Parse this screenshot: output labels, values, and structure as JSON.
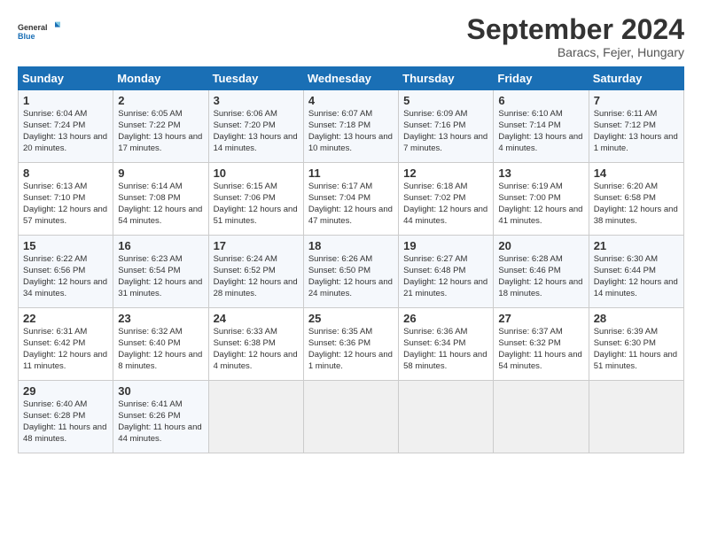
{
  "logo": {
    "line1": "General",
    "line2": "Blue"
  },
  "title": "September 2024",
  "subtitle": "Baracs, Fejer, Hungary",
  "days_of_week": [
    "Sunday",
    "Monday",
    "Tuesday",
    "Wednesday",
    "Thursday",
    "Friday",
    "Saturday"
  ],
  "weeks": [
    [
      {
        "day": "1",
        "rise": "Sunrise: 6:04 AM",
        "set": "Sunset: 7:24 PM",
        "daylight": "Daylight: 13 hours and 20 minutes."
      },
      {
        "day": "2",
        "rise": "Sunrise: 6:05 AM",
        "set": "Sunset: 7:22 PM",
        "daylight": "Daylight: 13 hours and 17 minutes."
      },
      {
        "day": "3",
        "rise": "Sunrise: 6:06 AM",
        "set": "Sunset: 7:20 PM",
        "daylight": "Daylight: 13 hours and 14 minutes."
      },
      {
        "day": "4",
        "rise": "Sunrise: 6:07 AM",
        "set": "Sunset: 7:18 PM",
        "daylight": "Daylight: 13 hours and 10 minutes."
      },
      {
        "day": "5",
        "rise": "Sunrise: 6:09 AM",
        "set": "Sunset: 7:16 PM",
        "daylight": "Daylight: 13 hours and 7 minutes."
      },
      {
        "day": "6",
        "rise": "Sunrise: 6:10 AM",
        "set": "Sunset: 7:14 PM",
        "daylight": "Daylight: 13 hours and 4 minutes."
      },
      {
        "day": "7",
        "rise": "Sunrise: 6:11 AM",
        "set": "Sunset: 7:12 PM",
        "daylight": "Daylight: 13 hours and 1 minute."
      }
    ],
    [
      {
        "day": "8",
        "rise": "Sunrise: 6:13 AM",
        "set": "Sunset: 7:10 PM",
        "daylight": "Daylight: 12 hours and 57 minutes."
      },
      {
        "day": "9",
        "rise": "Sunrise: 6:14 AM",
        "set": "Sunset: 7:08 PM",
        "daylight": "Daylight: 12 hours and 54 minutes."
      },
      {
        "day": "10",
        "rise": "Sunrise: 6:15 AM",
        "set": "Sunset: 7:06 PM",
        "daylight": "Daylight: 12 hours and 51 minutes."
      },
      {
        "day": "11",
        "rise": "Sunrise: 6:17 AM",
        "set": "Sunset: 7:04 PM",
        "daylight": "Daylight: 12 hours and 47 minutes."
      },
      {
        "day": "12",
        "rise": "Sunrise: 6:18 AM",
        "set": "Sunset: 7:02 PM",
        "daylight": "Daylight: 12 hours and 44 minutes."
      },
      {
        "day": "13",
        "rise": "Sunrise: 6:19 AM",
        "set": "Sunset: 7:00 PM",
        "daylight": "Daylight: 12 hours and 41 minutes."
      },
      {
        "day": "14",
        "rise": "Sunrise: 6:20 AM",
        "set": "Sunset: 6:58 PM",
        "daylight": "Daylight: 12 hours and 38 minutes."
      }
    ],
    [
      {
        "day": "15",
        "rise": "Sunrise: 6:22 AM",
        "set": "Sunset: 6:56 PM",
        "daylight": "Daylight: 12 hours and 34 minutes."
      },
      {
        "day": "16",
        "rise": "Sunrise: 6:23 AM",
        "set": "Sunset: 6:54 PM",
        "daylight": "Daylight: 12 hours and 31 minutes."
      },
      {
        "day": "17",
        "rise": "Sunrise: 6:24 AM",
        "set": "Sunset: 6:52 PM",
        "daylight": "Daylight: 12 hours and 28 minutes."
      },
      {
        "day": "18",
        "rise": "Sunrise: 6:26 AM",
        "set": "Sunset: 6:50 PM",
        "daylight": "Daylight: 12 hours and 24 minutes."
      },
      {
        "day": "19",
        "rise": "Sunrise: 6:27 AM",
        "set": "Sunset: 6:48 PM",
        "daylight": "Daylight: 12 hours and 21 minutes."
      },
      {
        "day": "20",
        "rise": "Sunrise: 6:28 AM",
        "set": "Sunset: 6:46 PM",
        "daylight": "Daylight: 12 hours and 18 minutes."
      },
      {
        "day": "21",
        "rise": "Sunrise: 6:30 AM",
        "set": "Sunset: 6:44 PM",
        "daylight": "Daylight: 12 hours and 14 minutes."
      }
    ],
    [
      {
        "day": "22",
        "rise": "Sunrise: 6:31 AM",
        "set": "Sunset: 6:42 PM",
        "daylight": "Daylight: 12 hours and 11 minutes."
      },
      {
        "day": "23",
        "rise": "Sunrise: 6:32 AM",
        "set": "Sunset: 6:40 PM",
        "daylight": "Daylight: 12 hours and 8 minutes."
      },
      {
        "day": "24",
        "rise": "Sunrise: 6:33 AM",
        "set": "Sunset: 6:38 PM",
        "daylight": "Daylight: 12 hours and 4 minutes."
      },
      {
        "day": "25",
        "rise": "Sunrise: 6:35 AM",
        "set": "Sunset: 6:36 PM",
        "daylight": "Daylight: 12 hours and 1 minute."
      },
      {
        "day": "26",
        "rise": "Sunrise: 6:36 AM",
        "set": "Sunset: 6:34 PM",
        "daylight": "Daylight: 11 hours and 58 minutes."
      },
      {
        "day": "27",
        "rise": "Sunrise: 6:37 AM",
        "set": "Sunset: 6:32 PM",
        "daylight": "Daylight: 11 hours and 54 minutes."
      },
      {
        "day": "28",
        "rise": "Sunrise: 6:39 AM",
        "set": "Sunset: 6:30 PM",
        "daylight": "Daylight: 11 hours and 51 minutes."
      }
    ],
    [
      {
        "day": "29",
        "rise": "Sunrise: 6:40 AM",
        "set": "Sunset: 6:28 PM",
        "daylight": "Daylight: 11 hours and 48 minutes."
      },
      {
        "day": "30",
        "rise": "Sunrise: 6:41 AM",
        "set": "Sunset: 6:26 PM",
        "daylight": "Daylight: 11 hours and 44 minutes."
      },
      null,
      null,
      null,
      null,
      null
    ]
  ]
}
